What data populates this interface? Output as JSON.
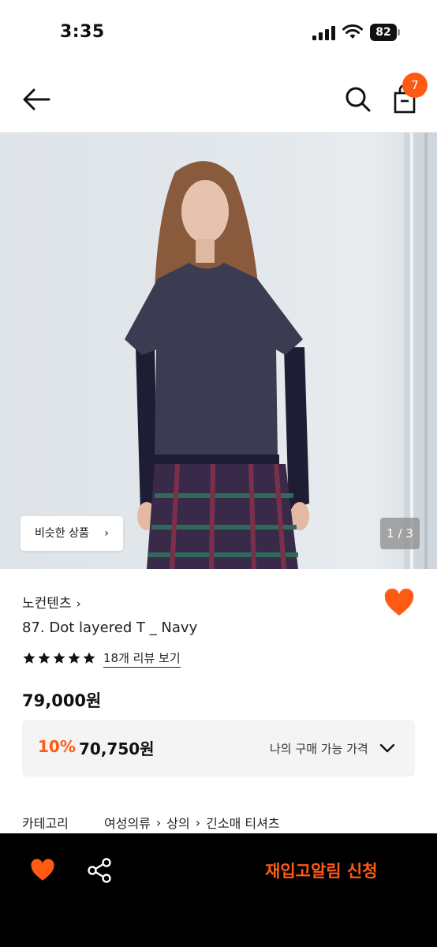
{
  "status_bar": {
    "time": "3:35",
    "battery": "82"
  },
  "header": {
    "cart_count": "7"
  },
  "gallery": {
    "similar_label": "비슷한 상품",
    "page_indicator": "1 / 3"
  },
  "product": {
    "brand": "노컨텐츠",
    "name": "87. Dot layered T _ Navy",
    "rating_stars": 5,
    "review_link": "18개 리뷰 보기",
    "price": "79,000원"
  },
  "price_box": {
    "discount_rate": "10%",
    "discount_price": "70,750원",
    "label": "나의 구매 가능 가격"
  },
  "category": {
    "label": "카테고리",
    "path": [
      "여성의류",
      "상의",
      "긴소매 티셔츠"
    ]
  },
  "bottom_bar": {
    "restock_label": "재입고알림 신청"
  },
  "colors": {
    "accent": "#ff5a14",
    "bar_bg": "#000000"
  }
}
